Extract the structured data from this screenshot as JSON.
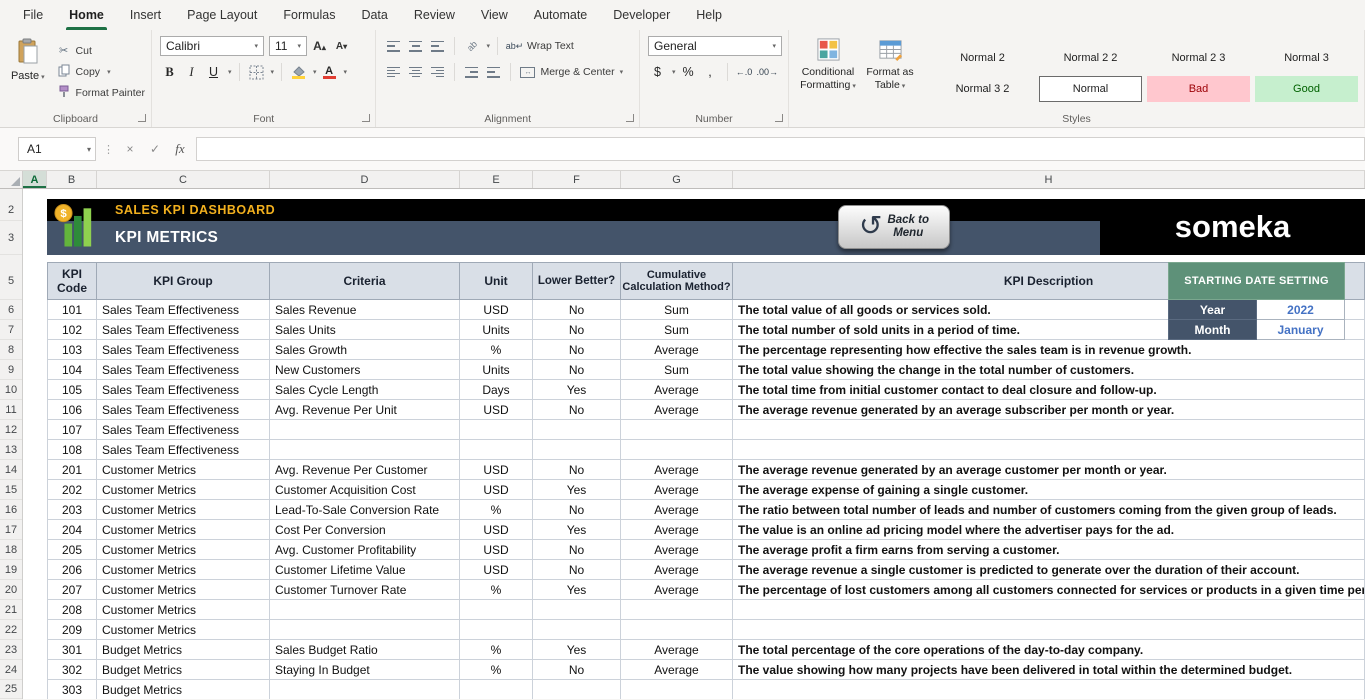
{
  "ribbon": {
    "tabs": [
      {
        "label": "File"
      },
      {
        "label": "Home",
        "active": true
      },
      {
        "label": "Insert"
      },
      {
        "label": "Page Layout"
      },
      {
        "label": "Formulas"
      },
      {
        "label": "Data"
      },
      {
        "label": "Review"
      },
      {
        "label": "View"
      },
      {
        "label": "Automate"
      },
      {
        "label": "Developer"
      },
      {
        "label": "Help"
      }
    ],
    "clipboard": {
      "label": "Clipboard",
      "paste": "Paste",
      "cut": "Cut",
      "copy": "Copy",
      "format_painter": "Format Painter"
    },
    "font": {
      "label": "Font",
      "family": "Calibri",
      "size": "11"
    },
    "alignment": {
      "label": "Alignment",
      "wrap_text": "Wrap Text",
      "merge_center": "Merge & Center"
    },
    "number": {
      "label": "Number",
      "format": "General",
      "currency": "$",
      "percent": "%",
      "comma": ",",
      "inc_decimal": "←.0",
      "dec_decimal": ".00→"
    },
    "styles": {
      "label": "Styles",
      "conditional_line1": "Conditional",
      "conditional_line2": "Formatting",
      "table_line1": "Format as",
      "table_line2": "Table",
      "gallery": [
        {
          "label": "Normal 2"
        },
        {
          "label": "Normal 2 2"
        },
        {
          "label": "Normal 2 3"
        },
        {
          "label": "Normal 3"
        },
        {
          "label": "Normal 3 2"
        },
        {
          "label": "Normal",
          "selected": true
        },
        {
          "label": "Bad",
          "kind": "bad"
        },
        {
          "label": "Good",
          "kind": "good"
        }
      ]
    }
  },
  "formula_bar": {
    "cell_ref": "A1",
    "fx": "fx"
  },
  "grid": {
    "columns": [
      "A",
      "B",
      "C",
      "D",
      "E",
      "F",
      "G",
      "H"
    ],
    "rows": [
      "2",
      "3",
      "5",
      "6",
      "7",
      "8",
      "9",
      "10",
      "11",
      "12",
      "13",
      "14",
      "15",
      "16",
      "17",
      "18",
      "19",
      "20",
      "21",
      "22",
      "23",
      "24",
      "25"
    ]
  },
  "sheet": {
    "title": "SALES KPI DASHBOARD",
    "subtitle": "KPI METRICS",
    "logo": "someka",
    "back_button": {
      "line1": "Back to",
      "line2": "Menu"
    },
    "date_setting": {
      "title": "STARTING DATE SETTING",
      "year_label": "Year",
      "year_value": "2022",
      "month_label": "Month",
      "month_value": "January"
    },
    "table": {
      "headers": {
        "code": "KPI Code",
        "group": "KPI Group",
        "criteria": "Criteria",
        "unit": "Unit",
        "lower": "Lower Better?",
        "calc": "Cumulative Calculation Method?",
        "desc": "KPI Description"
      },
      "rows": [
        {
          "code": "101",
          "group": "Sales Team Effectiveness",
          "criteria": "Sales Revenue",
          "unit": "USD",
          "lower": "No",
          "calc": "Sum",
          "desc": "The total value of all goods or services sold."
        },
        {
          "code": "102",
          "group": "Sales Team Effectiveness",
          "criteria": "Sales Units",
          "unit": "Units",
          "lower": "No",
          "calc": "Sum",
          "desc": "The total number of sold units in a period of time."
        },
        {
          "code": "103",
          "group": "Sales Team Effectiveness",
          "criteria": "Sales Growth",
          "unit": "%",
          "lower": "No",
          "calc": "Average",
          "desc": "The percentage representing how effective the sales team is in revenue growth."
        },
        {
          "code": "104",
          "group": "Sales Team Effectiveness",
          "criteria": "New Customers",
          "unit": "Units",
          "lower": "No",
          "calc": "Sum",
          "desc": "The total value showing the change in the total number of customers."
        },
        {
          "code": "105",
          "group": "Sales Team Effectiveness",
          "criteria": "Sales Cycle Length",
          "unit": "Days",
          "lower": "Yes",
          "calc": "Average",
          "desc": "The total time from initial customer contact to deal closure and follow-up."
        },
        {
          "code": "106",
          "group": "Sales Team Effectiveness",
          "criteria": "Avg. Revenue Per Unit",
          "unit": "USD",
          "lower": "No",
          "calc": "Average",
          "desc": "The average revenue generated by an average subscriber per month or year."
        },
        {
          "code": "107",
          "group": "Sales Team Effectiveness",
          "criteria": "",
          "unit": "",
          "lower": "",
          "calc": "",
          "desc": ""
        },
        {
          "code": "108",
          "group": "Sales Team Effectiveness",
          "criteria": "",
          "unit": "",
          "lower": "",
          "calc": "",
          "desc": ""
        },
        {
          "code": "201",
          "group": "Customer Metrics",
          "criteria": "Avg. Revenue Per Customer",
          "unit": "USD",
          "lower": "No",
          "calc": "Average",
          "desc": "The average revenue generated by an average customer per month or year."
        },
        {
          "code": "202",
          "group": "Customer Metrics",
          "criteria": "Customer Acquisition Cost",
          "unit": "USD",
          "lower": "Yes",
          "calc": "Average",
          "desc": "The average expense of gaining a single customer."
        },
        {
          "code": "203",
          "group": "Customer Metrics",
          "criteria": "Lead-To-Sale Conversion Rate",
          "unit": "%",
          "lower": "No",
          "calc": "Average",
          "desc": "The ratio between total number of leads and number of customers coming from the given group of leads."
        },
        {
          "code": "204",
          "group": "Customer Metrics",
          "criteria": "Cost Per Conversion",
          "unit": "USD",
          "lower": "Yes",
          "calc": "Average",
          "desc": "The value is an online ad pricing model where the advertiser pays for the ad."
        },
        {
          "code": "205",
          "group": "Customer Metrics",
          "criteria": "Avg. Customer Profitability",
          "unit": "USD",
          "lower": "No",
          "calc": "Average",
          "desc": "The average profit a firm earns from serving a customer."
        },
        {
          "code": "206",
          "group": "Customer Metrics",
          "criteria": "Customer Lifetime Value",
          "unit": "USD",
          "lower": "No",
          "calc": "Average",
          "desc": "The average revenue a single customer is predicted to generate over the duration of their account."
        },
        {
          "code": "207",
          "group": "Customer Metrics",
          "criteria": "Customer Turnover Rate",
          "unit": "%",
          "lower": "Yes",
          "calc": "Average",
          "desc": "The percentage of lost customers among all customers connected for services or products in a given time period."
        },
        {
          "code": "208",
          "group": "Customer Metrics",
          "criteria": "",
          "unit": "",
          "lower": "",
          "calc": "",
          "desc": ""
        },
        {
          "code": "209",
          "group": "Customer Metrics",
          "criteria": "",
          "unit": "",
          "lower": "",
          "calc": "",
          "desc": ""
        },
        {
          "code": "301",
          "group": "Budget Metrics",
          "criteria": "Sales Budget Ratio",
          "unit": "%",
          "lower": "Yes",
          "calc": "Average",
          "desc": "The total percentage of the core operations of the day-to-day company."
        },
        {
          "code": "302",
          "group": "Budget Metrics",
          "criteria": "Staying In Budget",
          "unit": "%",
          "lower": "No",
          "calc": "Average",
          "desc": "The value showing how many projects have been delivered in total within the determined budget."
        },
        {
          "code": "303",
          "group": "Budget Metrics",
          "criteria": "",
          "unit": "",
          "lower": "",
          "calc": "",
          "desc": ""
        }
      ]
    }
  },
  "colors": {
    "accent_green": "#1E7145",
    "title_gold": "#F2B01E",
    "band_black": "#000000",
    "band_slate": "#44546A",
    "date_green": "#5E9179",
    "value_blue": "#4472C4",
    "bad_bg": "#FFC7CE",
    "bad_text": "#9C0006",
    "good_bg": "#C6EFCE",
    "good_text": "#006100",
    "header_fill": "#D9DFE7"
  }
}
